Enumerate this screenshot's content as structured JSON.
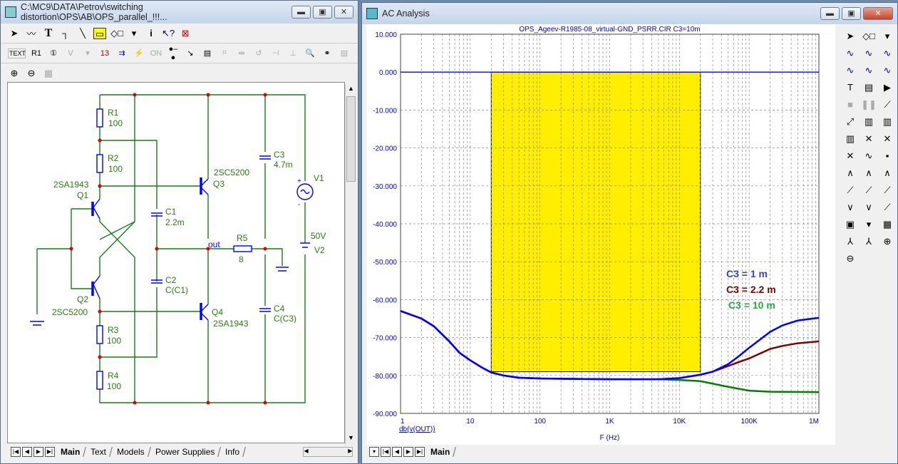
{
  "schematic_window": {
    "title": "C:\\MC9\\DATA\\Petrov\\switching distortion\\OPS\\AB\\OPS_parallel_!!!...",
    "toolbar1": [
      "select-arrow-icon",
      "wire-icon",
      "text-icon",
      "wire-orthogonal-icon",
      "line-icon",
      "component-icon",
      "shapes-icon",
      "dropdown-icon",
      "info-icon",
      "help-cursor-icon",
      "stop-icon"
    ],
    "toolbar2_text_label": "TEXT",
    "toolbar2": [
      "attribute-r1-icon",
      "node-number-icon",
      "pin-voltage-icon",
      "dropdown-icon",
      "node-13-icon",
      "current-icon",
      "power-icon",
      "on-state-icon",
      "pin-connection-icon",
      "cursor-probe-icon",
      "properties-icon",
      "grid-icon",
      "flip-icon",
      "rotate-icon",
      "mirror-icon",
      "mirror-v-icon",
      "find-icon",
      "binoculars-icon",
      "text-page-icon"
    ],
    "toolbar3": [
      "zoom-in-icon",
      "zoom-out-icon",
      "camera-icon"
    ],
    "tabs": [
      "Main",
      "Text",
      "Models",
      "Power Supplies",
      "Info"
    ],
    "active_tab": "Main",
    "components": {
      "R1": {
        "name": "R1",
        "value": "100"
      },
      "R2": {
        "name": "R2",
        "value": "100"
      },
      "R3": {
        "name": "R3",
        "value": "100"
      },
      "R4": {
        "name": "R4",
        "value": "100"
      },
      "R5": {
        "name": "R5",
        "value": "8"
      },
      "Q1": {
        "name": "Q1",
        "model": "2SA1943"
      },
      "Q2": {
        "name": "Q2",
        "model": "2SC5200"
      },
      "Q3": {
        "name": "Q3",
        "model": "2SC5200"
      },
      "Q4": {
        "name": "Q4",
        "model": "2SA1943"
      },
      "C1": {
        "name": "C1",
        "value": "2.2m"
      },
      "C2": {
        "name": "C2",
        "value": "C(C1)"
      },
      "C3": {
        "name": "C3",
        "value": "4.7m"
      },
      "C4": {
        "name": "C4",
        "value": "C(C3)"
      },
      "V1": {
        "name": "V1",
        "plus": "+",
        "minus": "-"
      },
      "V2": {
        "name": "V2",
        "value": "50V"
      },
      "out_label": "out"
    },
    "colors": {
      "wire": "#1a7a1a",
      "component": "#0000ff",
      "node": "#e00000",
      "label": "#2a7a10"
    }
  },
  "analysis_window": {
    "title": "AC Analysis",
    "tabs": [
      "Main"
    ],
    "active_tab": "Main",
    "right_toolbar": [
      "select-arrow-icon",
      "shapes-icon",
      "dropdown-icon",
      "waveform-1-icon",
      "waveform-2-icon",
      "waveform-3-icon",
      "waveform-4-icon",
      "waveform-5-icon",
      "waveform-6-icon",
      "text-icon",
      "properties-icon",
      "run-icon",
      "stop-icon",
      "pause-icon",
      "line-icon",
      "line-dots-icon",
      "grid-1-icon",
      "grid-2-icon",
      "grid-3-icon",
      "cursor-1-icon",
      "cursor-2-icon",
      "cursor-3-icon",
      "wave-red-icon",
      "scale-icon",
      "peak-1-icon",
      "peak-2-icon",
      "peak-3-icon",
      "slope-1-icon",
      "slope-2-icon",
      "slope-3-icon",
      "valley-1-icon",
      "valley-2-icon",
      "slope-4-icon",
      "tag-icon",
      "dropdown-icon",
      "table-icon",
      "x-scale-icon",
      "y-scale-icon",
      "zoom-in-icon",
      "zoom-out-icon"
    ]
  },
  "chart_data": {
    "type": "line",
    "title": "OPS_Ageev-R1985-08_virtual-GND_PSRR.CIR C3=10m",
    "xlabel": "F (Hz)",
    "ylabel": "db(v(OUT))",
    "xscale": "log",
    "xlim": [
      1,
      1000000
    ],
    "ylim": [
      -90,
      10
    ],
    "grid": true,
    "x_ticks": [
      "1",
      "10",
      "100",
      "1K",
      "10K",
      "100K",
      "1M"
    ],
    "y_ticks": [
      "10.000",
      "0.000",
      "-10.000",
      "-20.000",
      "-30.000",
      "-40.000",
      "-50.000",
      "-60.000",
      "-70.000",
      "-80.000",
      "-90.000"
    ],
    "reference_line": {
      "y": 0,
      "color": "#0000ff"
    },
    "highlight_band": {
      "x": [
        20,
        20000
      ],
      "y": [
        -79,
        0
      ],
      "color": "#ffee00"
    },
    "legend_placement": "right",
    "series": [
      {
        "name": "C3 = 1 m",
        "color": "#0000ff",
        "label_color": "#3344cc",
        "x": [
          1,
          2,
          3,
          5,
          7,
          10,
          15,
          20,
          30,
          50,
          100,
          1000,
          5000,
          10000,
          20000,
          30000,
          50000,
          70000,
          100000,
          200000,
          300000,
          500000,
          1000000
        ],
        "y": [
          -63,
          -65,
          -67,
          -71,
          -74,
          -76,
          -78,
          -79.2,
          -80,
          -80.6,
          -80.8,
          -81,
          -81,
          -80.7,
          -79.8,
          -79,
          -77,
          -75,
          -72.7,
          -68.5,
          -66.8,
          -65.5,
          -64.8
        ]
      },
      {
        "name": "C3 = 2.2 m",
        "color": "#800000",
        "label_color": "#800000",
        "x": [
          1,
          2,
          3,
          5,
          7,
          10,
          15,
          20,
          30,
          50,
          100,
          1000,
          5000,
          10000,
          20000,
          30000,
          50000,
          70000,
          100000,
          200000,
          300000,
          500000,
          1000000
        ],
        "y": [
          -63,
          -65,
          -67,
          -71,
          -74,
          -76,
          -78,
          -79.2,
          -80,
          -80.6,
          -80.8,
          -81,
          -81,
          -80.7,
          -79.8,
          -79,
          -77.5,
          -76.5,
          -75.5,
          -73,
          -72.2,
          -71.5,
          -71
        ]
      },
      {
        "name": "C3 = 10 m",
        "color": "#008000",
        "label_color": "#22aa44",
        "x": [
          1,
          2,
          3,
          5,
          7,
          10,
          15,
          20,
          30,
          50,
          100,
          1000,
          5000,
          10000,
          20000,
          50000,
          100000,
          200000,
          1000000
        ],
        "y": [
          -63,
          -65,
          -67,
          -71,
          -74,
          -76,
          -78,
          -79.2,
          -80,
          -80.6,
          -80.8,
          -81,
          -81,
          -81.2,
          -81.5,
          -83,
          -84,
          -84.3,
          -84.4
        ]
      }
    ]
  }
}
